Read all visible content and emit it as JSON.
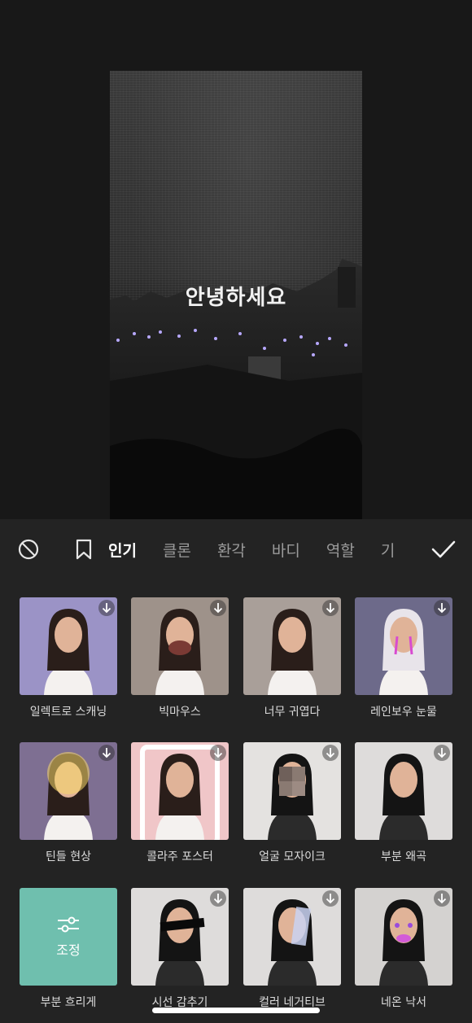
{
  "preview": {
    "overlay_text": "안녕하세요"
  },
  "toolbar": {
    "none_icon": "prohibit-icon",
    "bookmark_icon": "bookmark-icon",
    "confirm_icon": "checkmark-icon",
    "tabs": [
      {
        "label": "인기",
        "active": true
      },
      {
        "label": "클론",
        "active": false
      },
      {
        "label": "환각",
        "active": false
      },
      {
        "label": "바디",
        "active": false
      },
      {
        "label": "역할",
        "active": false
      },
      {
        "label": "기",
        "active": false
      }
    ]
  },
  "effects": [
    {
      "label": "일렉트로 스캐닝",
      "bg": "#9b93c6",
      "downloadable": true
    },
    {
      "label": "빅마우스",
      "bg": "#9e928a",
      "downloadable": true
    },
    {
      "label": "너무 귀엽다",
      "bg": "#a99f99",
      "downloadable": true
    },
    {
      "label": "레인보우 눈물",
      "bg": "#6d6a8a",
      "downloadable": true
    },
    {
      "label": "틴들 현상",
      "bg": "#7e6f92",
      "downloadable": true
    },
    {
      "label": "콜라주 포스터",
      "bg": "#f0c6c8",
      "downloadable": true
    },
    {
      "label": "얼굴 모자이크",
      "bg": "#e4e2e0",
      "downloadable": true
    },
    {
      "label": "부분 왜곡",
      "bg": "#dedcdb",
      "downloadable": true
    },
    {
      "label": "부분 흐리게",
      "bg": "#6fbfae",
      "downloadable": false,
      "adjust_text": "조정"
    },
    {
      "label": "시선 감추기",
      "bg": "#dedcdb",
      "downloadable": true
    },
    {
      "label": "컬러 네거티브",
      "bg": "#dedcdb",
      "downloadable": true
    },
    {
      "label": "네온 낙서",
      "bg": "#d4d2d0",
      "downloadable": true
    }
  ]
}
